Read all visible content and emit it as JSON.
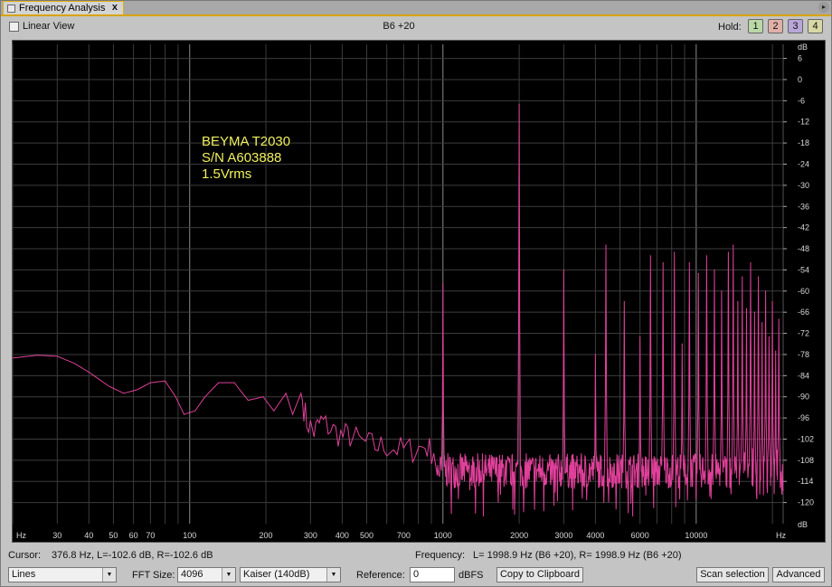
{
  "window": {
    "tab_title": "Frequency Analysis",
    "close_glyph": "x",
    "menu_glyph": "▸"
  },
  "toolbar": {
    "linear_view_label": "Linear View",
    "linear_view_checked": false,
    "track_name": "B6 +20",
    "hold_label": "Hold:",
    "hold_buttons": [
      {
        "label": "1",
        "color": "#b9d8a6"
      },
      {
        "label": "2",
        "color": "#e0b0a8"
      },
      {
        "label": "3",
        "color": "#b9a6d8"
      },
      {
        "label": "4",
        "color": "#d8d8a6"
      }
    ]
  },
  "chart_data": {
    "type": "line",
    "x_scale": "log",
    "xlim": [
      20,
      22050
    ],
    "ylim": [
      -126,
      10
    ],
    "y_ticks": [
      6,
      0,
      -6,
      -12,
      -18,
      -24,
      -30,
      -36,
      -42,
      -48,
      -54,
      -60,
      -66,
      -72,
      -78,
      -84,
      -90,
      -96,
      -102,
      -108,
      -114,
      -120
    ],
    "y_unit_label": "dB",
    "x_unit_label": "Hz",
    "x_tick_labels": [
      {
        "value": 30,
        "label": "30"
      },
      {
        "value": 40,
        "label": "40"
      },
      {
        "value": 50,
        "label": "50"
      },
      {
        "value": 60,
        "label": "60"
      },
      {
        "value": 70,
        "label": "70"
      },
      {
        "value": 100,
        "label": "100"
      },
      {
        "value": 200,
        "label": "200"
      },
      {
        "value": 300,
        "label": "300"
      },
      {
        "value": 400,
        "label": "400"
      },
      {
        "value": 500,
        "label": "500"
      },
      {
        "value": 700,
        "label": "700"
      },
      {
        "value": 1000,
        "label": "1000"
      },
      {
        "value": 2000,
        "label": "2000"
      },
      {
        "value": 3000,
        "label": "3000"
      },
      {
        "value": 4000,
        "label": "4000"
      },
      {
        "value": 6000,
        "label": "6000"
      },
      {
        "value": 10000,
        "label": "10000"
      }
    ],
    "grid": true,
    "annotation_lines": [
      "BEYMA T2030",
      "S/N A603888",
      "1.5Vrms"
    ],
    "annotation_color": "#f0f060",
    "series_color": "#e0409a",
    "fundamental_hz": 2000,
    "fundamental_db": -7,
    "baseline_points": [
      [
        20,
        -79
      ],
      [
        25,
        -78.2
      ],
      [
        30,
        -78.5
      ],
      [
        35,
        -80.5
      ],
      [
        40,
        -83
      ],
      [
        48,
        -87
      ],
      [
        55,
        -89
      ],
      [
        62,
        -88
      ],
      [
        70,
        -86
      ],
      [
        80,
        -85.5
      ],
      [
        88,
        -90
      ],
      [
        95,
        -95
      ],
      [
        105,
        -94
      ],
      [
        115,
        -90
      ],
      [
        130,
        -86
      ],
      [
        150,
        -86
      ],
      [
        170,
        -91
      ],
      [
        195,
        -90
      ],
      [
        215,
        -94
      ],
      [
        240,
        -89
      ],
      [
        255,
        -95
      ],
      [
        275,
        -89
      ],
      [
        290,
        -97
      ],
      [
        310,
        -100
      ],
      [
        330,
        -97
      ],
      [
        360,
        -99
      ],
      [
        395,
        -101
      ],
      [
        430,
        -101
      ],
      [
        480,
        -103
      ],
      [
        540,
        -104
      ],
      [
        600,
        -104
      ],
      [
        680,
        -105
      ],
      [
        760,
        -105
      ],
      [
        850,
        -104
      ],
      [
        920,
        -106
      ]
    ],
    "noise_floor_db": -111,
    "noise_floor_after_hz": 950,
    "peaks": [
      {
        "hz": 1000,
        "db": -58
      },
      {
        "hz": 2000,
        "db": -7
      },
      {
        "hz": 3000,
        "db": -54
      },
      {
        "hz": 4000,
        "db": -78
      },
      {
        "hz": 4400,
        "db": -47
      },
      {
        "hz": 5200,
        "db": -63
      },
      {
        "hz": 6000,
        "db": -73
      },
      {
        "hz": 6600,
        "db": -50
      },
      {
        "hz": 7400,
        "db": -52
      },
      {
        "hz": 8200,
        "db": -49
      },
      {
        "hz": 8800,
        "db": -75
      },
      {
        "hz": 9400,
        "db": -52
      },
      {
        "hz": 10200,
        "db": -55
      },
      {
        "hz": 11000,
        "db": -50
      },
      {
        "hz": 11800,
        "db": -54
      },
      {
        "hz": 12600,
        "db": -60
      },
      {
        "hz": 13400,
        "db": -49
      },
      {
        "hz": 14000,
        "db": -47
      },
      {
        "hz": 14600,
        "db": -63
      },
      {
        "hz": 15200,
        "db": -56
      },
      {
        "hz": 15800,
        "db": -65
      },
      {
        "hz": 16400,
        "db": -52
      },
      {
        "hz": 17000,
        "db": -66
      },
      {
        "hz": 17600,
        "db": -56
      },
      {
        "hz": 18200,
        "db": -69
      },
      {
        "hz": 18800,
        "db": -60
      },
      {
        "hz": 19400,
        "db": -73
      },
      {
        "hz": 20000,
        "db": -63
      },
      {
        "hz": 20600,
        "db": -77
      },
      {
        "hz": 21200,
        "db": -68
      }
    ]
  },
  "status": {
    "cursor_label": "Cursor:",
    "cursor_value": "376.8 Hz, L=-102.6 dB, R=-102.6 dB",
    "frequency_label": "Frequency:",
    "frequency_value": "L= 1998.9 Hz (B6 +20), R= 1998.9 Hz (B6 +20)"
  },
  "controls": {
    "display_mode": "Lines",
    "fft_size_label": "FFT Size:",
    "fft_size": "4096",
    "window": "Kaiser (140dB)",
    "reference_label": "Reference:",
    "reference_value": "0",
    "reference_unit": "dBFS",
    "copy_button": "Copy to Clipboard",
    "scan_button": "Scan selection",
    "advanced_button": "Advanced"
  }
}
